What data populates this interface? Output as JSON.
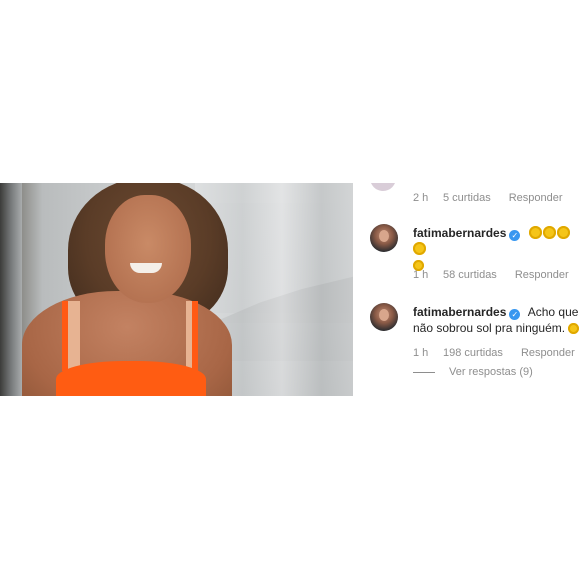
{
  "comments": [
    {
      "time": "2 h",
      "likes": "5 curtidas",
      "reply": "Responder"
    },
    {
      "username": "fatimabernardes",
      "text": "",
      "emoji": "sun",
      "time": "1 h",
      "likes": "58 curtidas",
      "reply": "Responder"
    },
    {
      "username": "fatimabernardes",
      "text_line1": "Acho que",
      "text_line2": "não sobrou sol pra ninguém.",
      "time": "1 h",
      "likes": "198 curtidas",
      "reply": "Responder",
      "view_replies": "Ver respostas (9)"
    }
  ],
  "colors": {
    "verified": "#3897f0",
    "meta_text": "#8e8e8e",
    "text": "#262626"
  }
}
